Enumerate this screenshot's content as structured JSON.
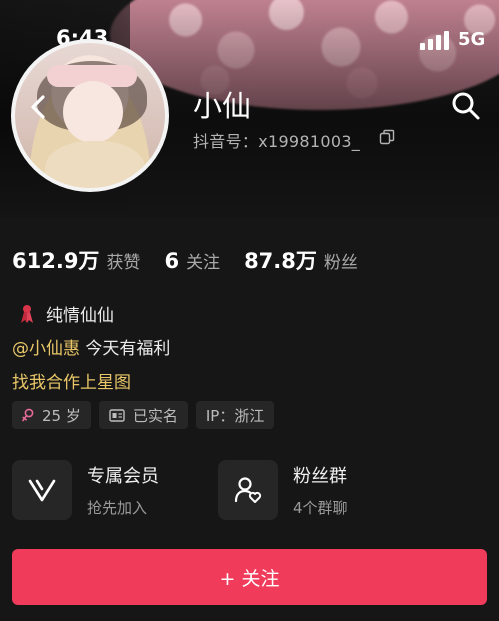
{
  "status_bar": {
    "time": "6:43",
    "network": "5G"
  },
  "profile": {
    "nickname": "小仙",
    "douyin_id": "抖音号：x19981003_"
  },
  "stats": [
    {
      "value": "612.9万",
      "label": "获赞"
    },
    {
      "value": "6",
      "label": "关注"
    },
    {
      "value": "87.8万",
      "label": "粉丝"
    }
  ],
  "bio": {
    "line1": "纯情仙仙",
    "mention": "@小仙惠",
    "line2_rest": " 今天有福利",
    "line3": "找我合作上星图"
  },
  "tags": [
    {
      "icon": "female-icon",
      "label": "25 岁"
    },
    {
      "icon": "id-card-icon",
      "label": "已实名"
    },
    {
      "icon": "",
      "label": "IP：浙江"
    }
  ],
  "features": [
    {
      "icon": "vip-v-icon",
      "title": "专属会员",
      "subtitle": "抢先加入"
    },
    {
      "icon": "fans-group-icon",
      "title": "粉丝群",
      "subtitle": "4个群聊"
    }
  ],
  "follow_button": {
    "label": "+ 关注"
  },
  "colors": {
    "accent": "#f03b5b",
    "highlight": "#e9c768",
    "background": "#161616"
  }
}
